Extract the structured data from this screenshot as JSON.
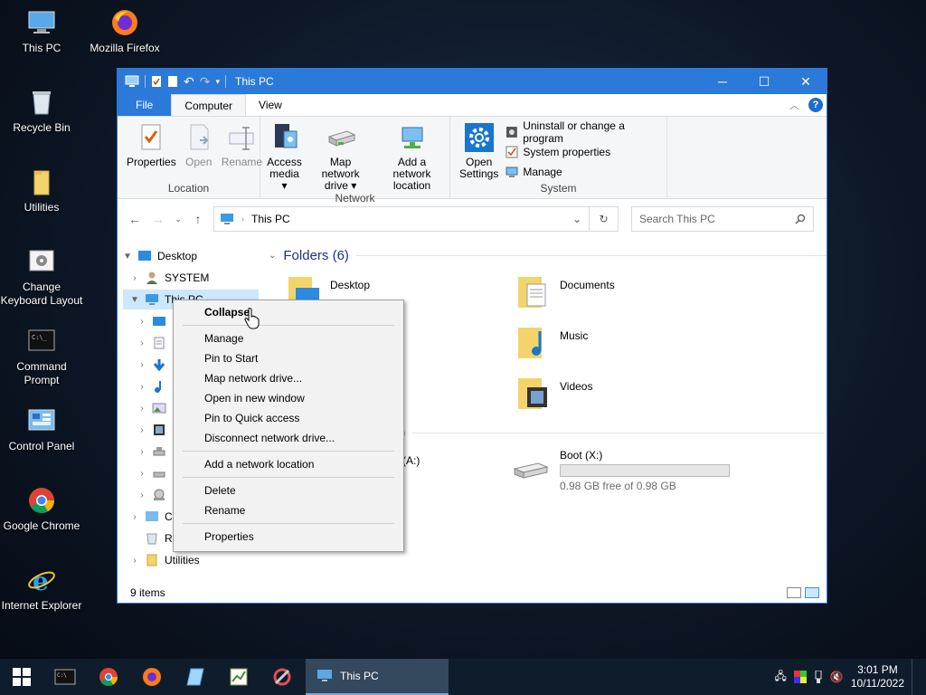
{
  "desktop": {
    "icons": [
      {
        "label": "This PC"
      },
      {
        "label": "Mozilla Firefox"
      },
      {
        "label": "Recycle Bin"
      },
      {
        "label": "Utilities"
      },
      {
        "label_line1": "Change",
        "label_line2": "Keyboard Layout"
      },
      {
        "label_line1": "Command",
        "label_line2": "Prompt"
      },
      {
        "label": "Control Panel"
      },
      {
        "label": "Google Chrome"
      },
      {
        "label": "Internet Explorer"
      }
    ]
  },
  "window": {
    "title": "This PC",
    "tabs": {
      "file": "File",
      "computer": "Computer",
      "view": "View"
    },
    "ribbon": {
      "location": {
        "label": "Location",
        "properties": "Properties",
        "open": "Open",
        "rename": "Rename"
      },
      "network": {
        "label": "Network",
        "access_media_1": "Access",
        "access_media_2": "media",
        "map_drive_1": "Map network",
        "map_drive_2": "drive",
        "add_location_1": "Add a network",
        "add_location_2": "location"
      },
      "system": {
        "label": "System",
        "open_settings_1": "Open",
        "open_settings_2": "Settings",
        "uninstall": "Uninstall or change a program",
        "system_properties": "System properties",
        "manage": "Manage"
      }
    },
    "address": {
      "path": "This PC",
      "search_placeholder": "Search This PC"
    },
    "nav": {
      "desktop": "Desktop",
      "system": "SYSTEM",
      "this_pc": "This PC",
      "c_partial": "C",
      "r_partial": "R",
      "utilities": "Utilities"
    },
    "main": {
      "folders_header": "Folders (6)",
      "drives_header_partial": "3)",
      "folders": [
        "Desktop",
        "Documents",
        "Music",
        "Videos"
      ],
      "drive_partial": "e (A:)",
      "boot_drive": {
        "name": "Boot (X:)",
        "free": "0.98 GB free of 0.98 GB",
        "used_fraction": 0.0
      }
    },
    "status": {
      "items": "9 items"
    }
  },
  "context_menu": {
    "items": [
      "Collapse",
      "Manage",
      "Pin to Start",
      "Map network drive...",
      "Open in new window",
      "Pin to Quick access",
      "Disconnect network drive...",
      "Add a network location",
      "Delete",
      "Rename",
      "Properties"
    ]
  },
  "taskbar": {
    "active_app": "This PC",
    "time": "3:01 PM",
    "date": "10/11/2022"
  },
  "colors": {
    "accent": "#2b79d8",
    "selection": "#cce8ff",
    "taskbar": "#0f1c2c"
  }
}
